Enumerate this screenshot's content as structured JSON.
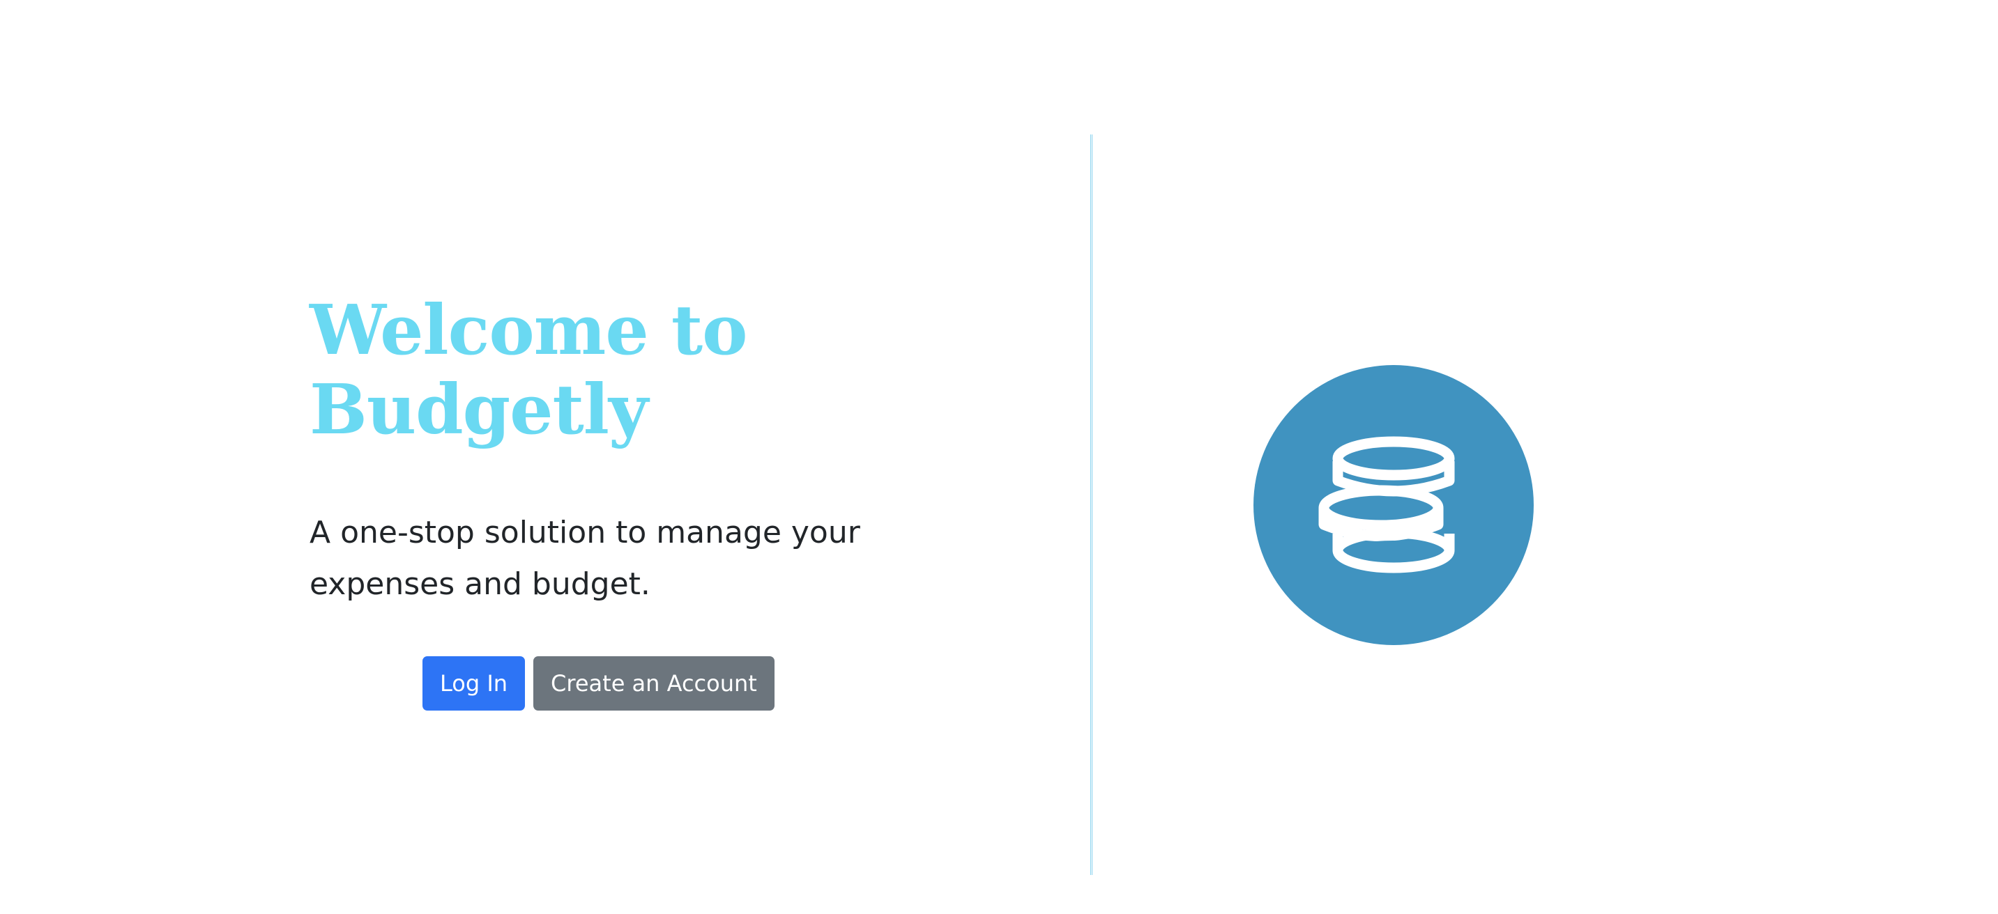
{
  "hero": {
    "title": "Welcome to Budgetly",
    "subtitle": "A one-stop solution to manage your expenses and budget."
  },
  "actions": {
    "login_label": "Log In",
    "register_label": "Create an Account"
  },
  "colors": {
    "title": "#6ad9f2",
    "primary": "#2d74f5",
    "secondary": "#6c757d",
    "logo_circle": "#4093c0",
    "divider": "#8ad3ef"
  },
  "logo": {
    "icon": "coin-stack-icon"
  }
}
